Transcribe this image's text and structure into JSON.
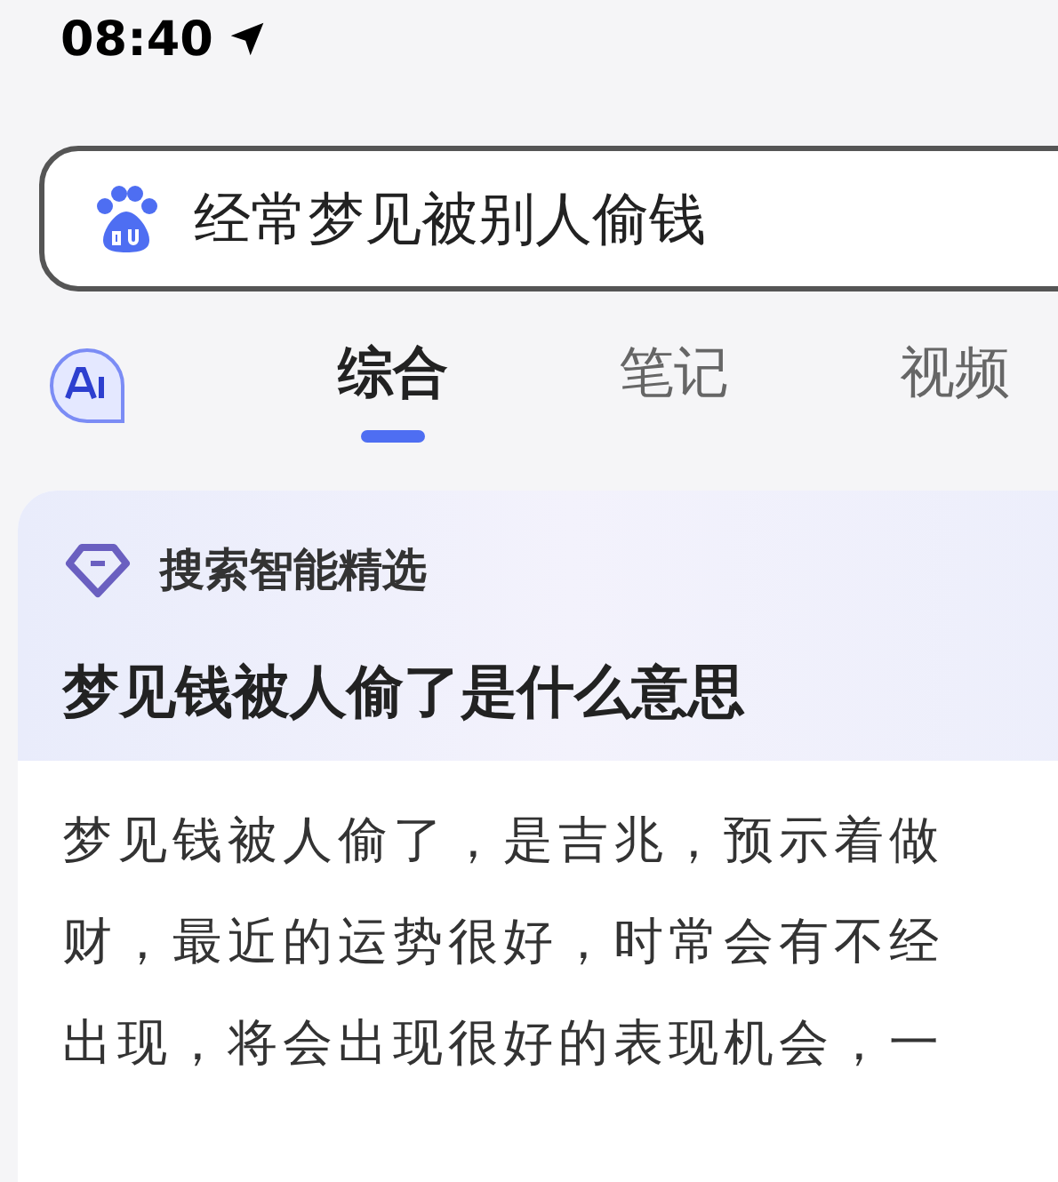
{
  "status_bar": {
    "time": "08:40"
  },
  "search": {
    "value": "经常梦见被别人偷钱"
  },
  "tabs": [
    {
      "label": "综合",
      "selected": true
    },
    {
      "label": "笔记",
      "selected": false
    },
    {
      "label": "视频",
      "selected": false
    }
  ],
  "card": {
    "badge": "搜索智能精选",
    "title": "梦见钱被人偷了是什么意思",
    "lines": [
      "梦见钱被人偷了，是吉兆，预示着做",
      "财，最近的运势很好，时常会有不经",
      "出现，将会出现很好的表现机会，一"
    ]
  }
}
